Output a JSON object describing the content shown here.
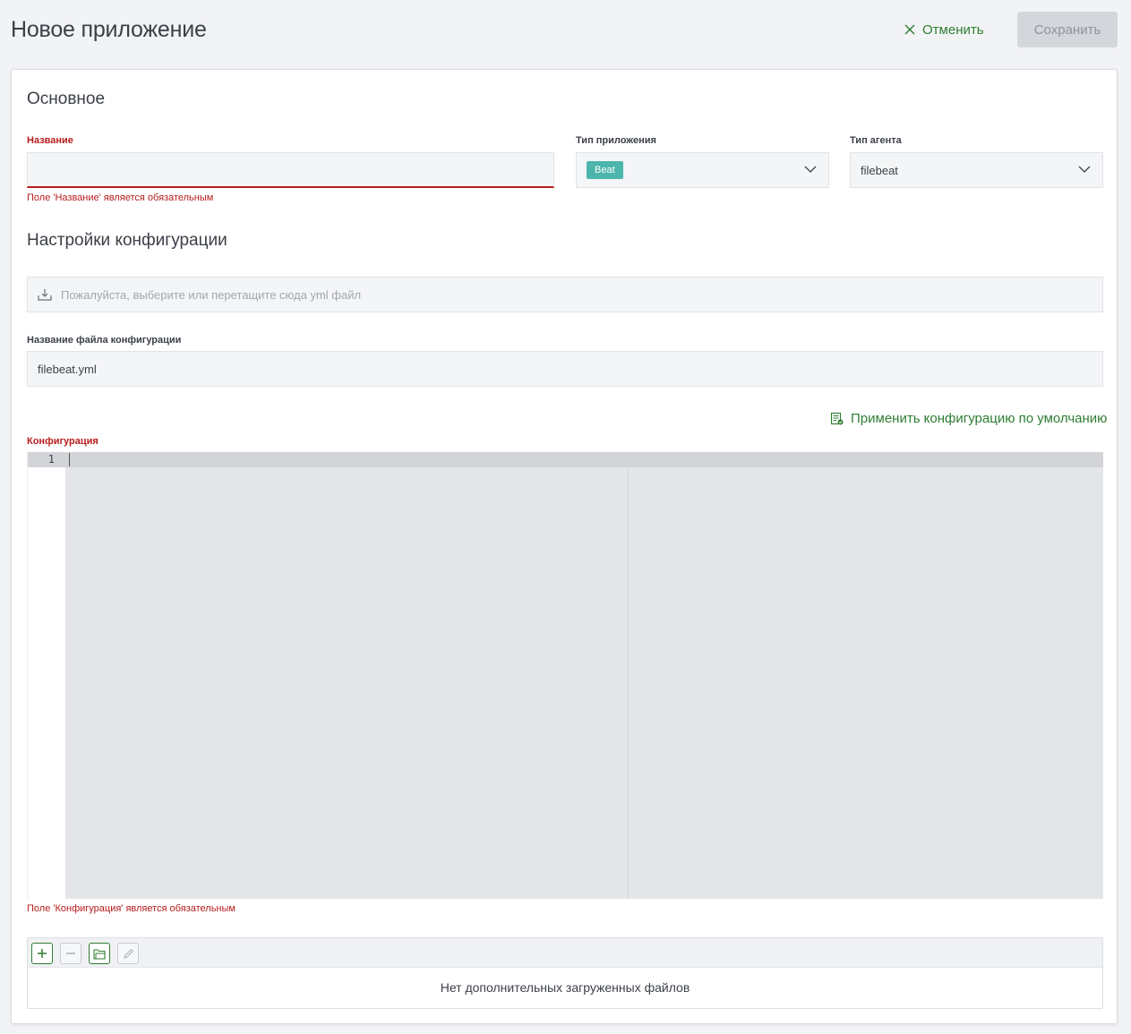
{
  "header": {
    "title": "Новое приложение",
    "cancel_label": "Отменить",
    "save_label": "Сохранить"
  },
  "basic": {
    "section_title": "Основное",
    "name": {
      "label": "Название",
      "value": "",
      "error": "Поле 'Название' является обязательным"
    },
    "app_type": {
      "label": "Тип приложения",
      "value": "Beat"
    },
    "agent_type": {
      "label": "Тип агента",
      "value": "filebeat"
    }
  },
  "config": {
    "section_title": "Настройки конфигурации",
    "dropzone_placeholder": "Пожалуйста, выберите или перетащите сюда yml файл",
    "filename_label": "Название файла конфигурации",
    "filename_value": "filebeat.yml",
    "default_link": "Применить конфигурацию по умолчанию",
    "editor_label": "Конфигурация",
    "editor_line": "1",
    "editor_error": "Поле 'Конфигурация' является обязательным"
  },
  "files": {
    "empty_text": "Нет дополнительных загруженных файлов"
  },
  "colors": {
    "accent": "#2e7d32",
    "error": "#b71c1c",
    "badge": "#4cb5ac"
  }
}
